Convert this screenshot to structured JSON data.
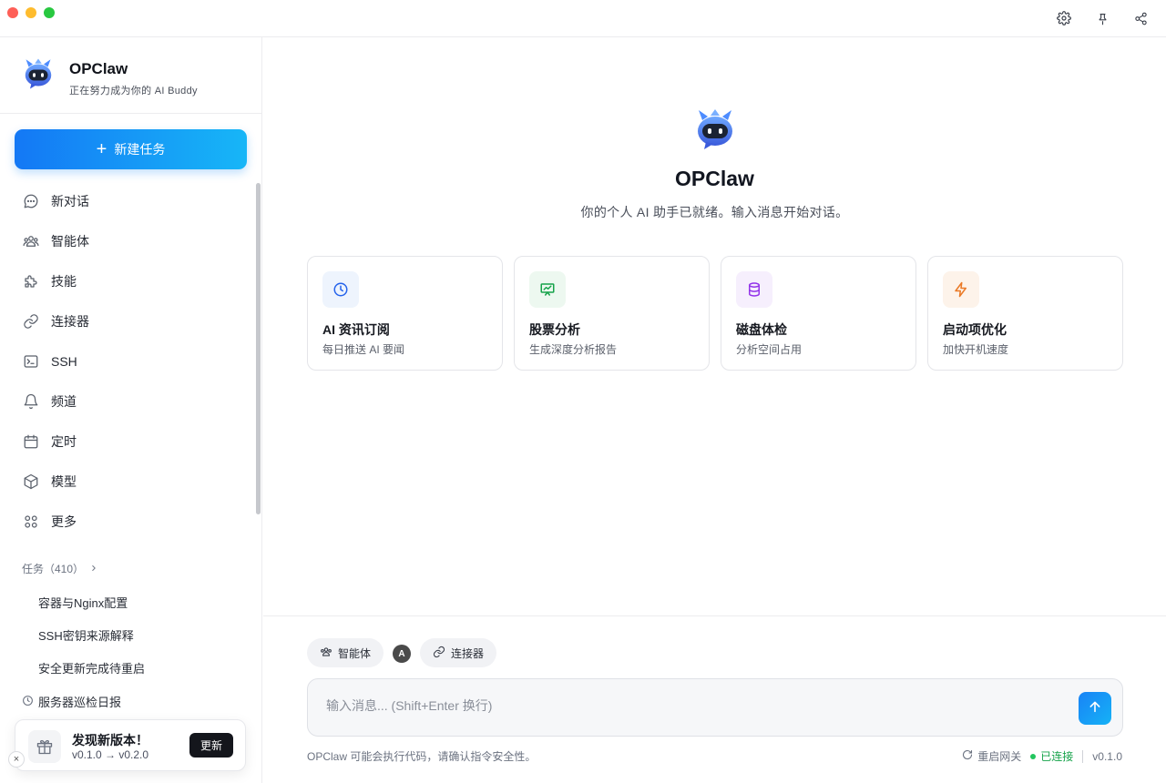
{
  "titlebar": {
    "icons": [
      "gear-icon",
      "pin-icon",
      "share-icon"
    ]
  },
  "sidebar": {
    "brand": {
      "name": "OPClaw",
      "tagline": "正在努力成为你的 AI Buddy"
    },
    "new_task_label": "新建任务",
    "nav": [
      {
        "label": "新对话",
        "icon": "chat-bubble-icon"
      },
      {
        "label": "智能体",
        "icon": "users-icon"
      },
      {
        "label": "技能",
        "icon": "puzzle-icon"
      },
      {
        "label": "连接器",
        "icon": "link-icon"
      },
      {
        "label": "SSH",
        "icon": "terminal-icon"
      },
      {
        "label": "频道",
        "icon": "bell-icon"
      },
      {
        "label": "定时",
        "icon": "calendar-icon"
      },
      {
        "label": "模型",
        "icon": "cube-icon"
      },
      {
        "label": "更多",
        "icon": "grid-icon"
      }
    ],
    "tasks": {
      "header": "任务（410）",
      "items": [
        "容器与Nginx配置",
        "SSH密钥来源解释",
        "安全更新完成待重启",
        "服务器巡检日报"
      ]
    },
    "update": {
      "title": "发现新版本！",
      "versions": "v0.1.0 → v0.2.0",
      "button": "更新",
      "close": "×"
    }
  },
  "main": {
    "hero": {
      "title": "OPClaw",
      "subtitle": "你的个人 AI 助手已就绪。输入消息开始对话。"
    },
    "cards": [
      {
        "title": "AI 资讯订阅",
        "subtitle": "每日推送 AI 要闻",
        "icon": "clock-icon",
        "accent": "#2563eb",
        "bg": "#eef4fd"
      },
      {
        "title": "股票分析",
        "subtitle": "生成深度分析报告",
        "icon": "presentation-chart-icon",
        "accent": "#16a34a",
        "bg": "#edf8f0"
      },
      {
        "title": "磁盘体检",
        "subtitle": "分析空间占用",
        "icon": "database-icon",
        "accent": "#9333ea",
        "bg": "#f6effd"
      },
      {
        "title": "启动项优化",
        "subtitle": "加快开机速度",
        "icon": "lightning-icon",
        "accent": "#ea7a27",
        "bg": "#fdf3ea"
      }
    ],
    "composer": {
      "agent_chip": "智能体",
      "avatar_letter": "A",
      "connector_chip": "连接器",
      "placeholder": "输入消息... (Shift+Enter 换行)",
      "value": ""
    },
    "footer": {
      "note": "OPClaw 可能会执行代码，请确认指令安全性。",
      "restart": "重启网关",
      "status": "已连接",
      "version": "v0.1.0"
    }
  },
  "colors": {
    "brand_gradient_start": "#1478f5",
    "brand_gradient_end": "#17b6f7",
    "status_green": "#16a34a"
  }
}
